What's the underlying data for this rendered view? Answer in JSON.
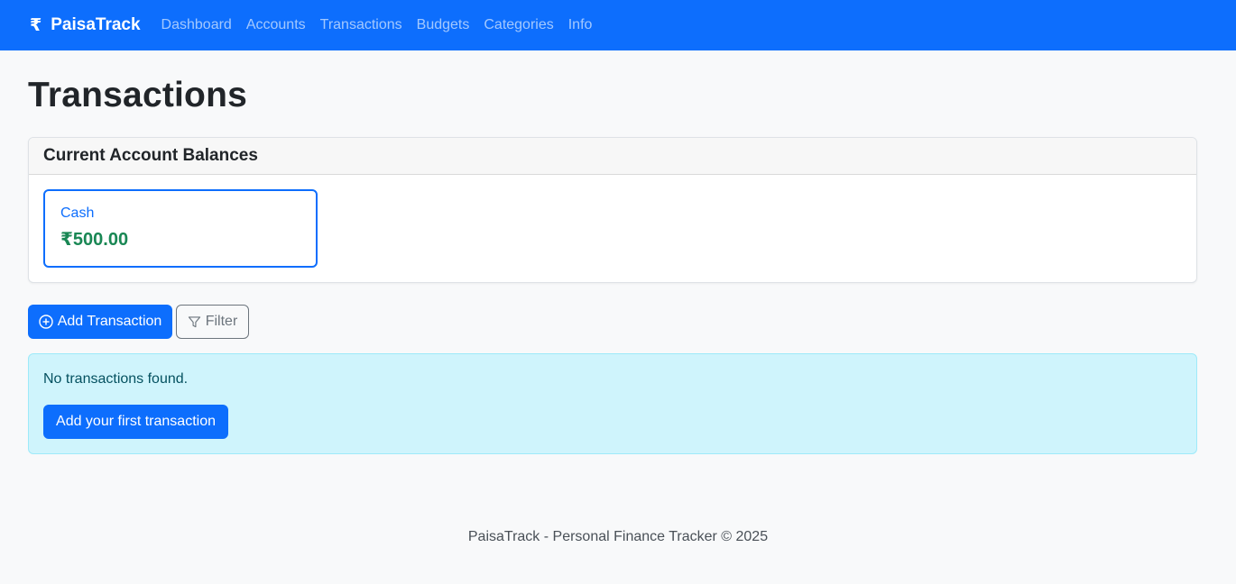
{
  "navbar": {
    "brand_icon": "rupee-icon",
    "brand_symbol": "₹",
    "brand_name": "PaisaTrack",
    "links": [
      "Dashboard",
      "Accounts",
      "Transactions",
      "Budgets",
      "Categories",
      "Info"
    ]
  },
  "page": {
    "title": "Transactions"
  },
  "balances": {
    "header": "Current Account Balances",
    "accounts": [
      {
        "name": "Cash",
        "amount": "₹500.00"
      }
    ]
  },
  "actions": {
    "add_label": "Add Transaction",
    "add_icon": "plus-circle-icon",
    "filter_label": "Filter",
    "filter_icon": "funnel-icon"
  },
  "empty_state": {
    "message": "No transactions found.",
    "button_label": "Add your first transaction"
  },
  "footer": {
    "text": "PaisaTrack - Personal Finance Tracker © 2025"
  },
  "colors": {
    "primary": "#0d6efd",
    "success": "#198754",
    "info_bg": "#cff4fc"
  }
}
